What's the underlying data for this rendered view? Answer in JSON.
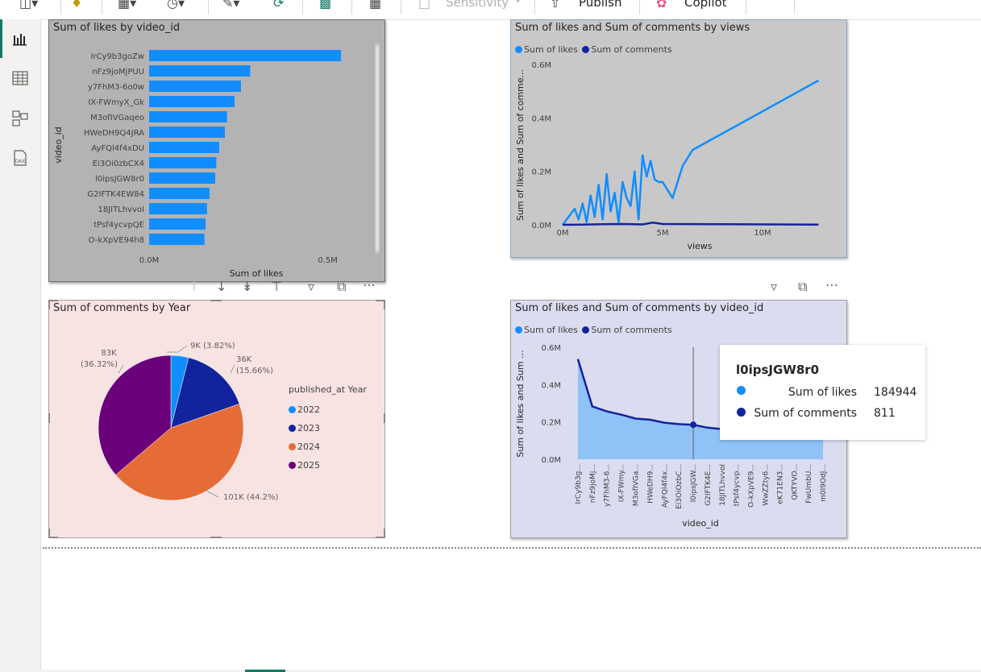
{
  "ribbon": {
    "sensitivity_label": "Sensitivity",
    "publish_label": "Publish",
    "copilot_label": "Copilot"
  },
  "rail": {
    "items": [
      {
        "name": "report-view",
        "icon": "bar-chart-icon"
      },
      {
        "name": "table-view",
        "icon": "table-icon"
      },
      {
        "name": "model-view",
        "icon": "model-icon"
      },
      {
        "name": "dax-query-view",
        "icon": "dax-icon",
        "label": "DAX"
      }
    ]
  },
  "colors": {
    "likes": "#118dff",
    "comments": "#12239e",
    "y2022": "#118dff",
    "y2023": "#12239e",
    "y2024": "#e66c37",
    "y2025": "#6b007b",
    "visual1_bg": "#b3b3b3",
    "visual2_bg": "#c8c8c8",
    "visual3_bg": "#f8e3e3",
    "visual4_bg": "#dcdcf0"
  },
  "visual1": {
    "title": "Sum of likes by video_id",
    "chart_data": {
      "type": "bar",
      "orientation": "horizontal",
      "categories": [
        "IrCy9b3goZw",
        "nFz9joMjPUU",
        "y7FhM3-6o0w",
        "IX-FWmyX_Gk",
        "M3ofIVGaqeo",
        "HWeDH9Q4JRA",
        "AyFQl4f4xDU",
        "Ei3Oi0zbCX4",
        "l0ipsJGW8r0",
        "G2IFTK4EW84",
        "18JITLhvvoI",
        "tPsf4ycvpQE",
        "O-kXpVE94h8"
      ],
      "values": [
        537000,
        283000,
        257000,
        239000,
        218000,
        212000,
        196000,
        188000,
        184944,
        169000,
        162000,
        158000,
        155000
      ],
      "xlabel": "Sum of likes",
      "ylabel": "video_id",
      "xticks": [
        "0.0M",
        "0.5M"
      ],
      "xlim": [
        0,
        600000
      ]
    }
  },
  "visual2": {
    "title": "Sum of likes and Sum of comments by views",
    "legend": [
      "Sum of likes",
      "Sum of comments"
    ],
    "chart_data": {
      "type": "line",
      "xlabel": "views",
      "ylabel": "Sum of likes and Sum of comme...",
      "xticks": [
        "0M",
        "5M",
        "10M"
      ],
      "yticks": [
        "0.0M",
        "0.2M",
        "0.4M",
        "0.6M"
      ],
      "xlim": [
        0,
        12500000
      ],
      "ylim": [
        0,
        600000
      ],
      "series": [
        {
          "name": "Sum of likes",
          "x": [
            0,
            200000,
            400000,
            600000,
            800000,
            1000000,
            1200000,
            1400000,
            1600000,
            1800000,
            2000000,
            2200000,
            2400000,
            2600000,
            2800000,
            3000000,
            3200000,
            3400000,
            3600000,
            3800000,
            4000000,
            4200000,
            4400000,
            4600000,
            4800000,
            5000000,
            5500000,
            6000000,
            6500000,
            12800000
          ],
          "y": [
            0,
            20000,
            40000,
            60000,
            20000,
            80000,
            10000,
            110000,
            30000,
            150000,
            20000,
            190000,
            50000,
            120000,
            10000,
            160000,
            100000,
            70000,
            200000,
            20000,
            260000,
            180000,
            240000,
            170000,
            160000,
            160000,
            100000,
            220000,
            280000,
            540000
          ]
        },
        {
          "name": "Sum of comments",
          "x": [
            0,
            1000000,
            2000000,
            3000000,
            4000000,
            4500000,
            5000000,
            8000000,
            12800000
          ],
          "y": [
            0,
            1000,
            2000,
            3000,
            1500,
            8000,
            3000,
            2000,
            1000
          ]
        }
      ]
    }
  },
  "visual3": {
    "title": "Sum of comments by Year",
    "legend_title": "published_at Year",
    "chart_data": {
      "type": "pie",
      "series_name": "published_at Year",
      "categories": [
        "2022",
        "2023",
        "2024",
        "2025"
      ],
      "values": [
        9000,
        36000,
        101000,
        83000
      ],
      "percents": [
        "3.82%",
        "15.66%",
        "44.2%",
        "36.32%"
      ],
      "value_labels": [
        "9K",
        "36K",
        "101K",
        "83K"
      ]
    },
    "labels": {
      "l2022": "9K (3.82%)",
      "l2023a": "36K",
      "l2023b": "(15.66%)",
      "l2024": "101K (44.2%)",
      "l2025a": "83K",
      "l2025b": "(36.32%)"
    }
  },
  "visual4": {
    "title": "Sum of likes and Sum of comments by video_id",
    "legend": [
      "Sum of likes",
      "Sum of comments"
    ],
    "chart_data": {
      "type": "area",
      "xlabel": "video_id",
      "ylabel": "Sum of likes and Sum ...",
      "categories": [
        "IrCy9b3g...",
        "nFz9joMj...",
        "y7FhM3-6...",
        "IX-FWmy...",
        "M3ofIVGa...",
        "HWeDH9...",
        "AyFQl4f4x...",
        "Ei3OiOzbC...",
        "l0ipsJGW...",
        "G2IFTK4E...",
        "18JITLhvvoI",
        "tPsf4ycvp...",
        "O-kXpVE9...",
        "WwZZty6...",
        "eK71EN3...",
        "QKTYVO...",
        "FwUmbU...",
        "m0I9OdJ..."
      ],
      "yticks": [
        "0.0M",
        "0.2M",
        "0.4M",
        "0.6M"
      ],
      "ylim": [
        0,
        600000
      ],
      "series": [
        {
          "name": "Sum of likes",
          "values": [
            537000,
            283000,
            257000,
            239000,
            218000,
            212000,
            196000,
            188000,
            184944,
            169000,
            162000,
            158000,
            155000,
            152000,
            150000,
            148000,
            146000,
            144000
          ]
        },
        {
          "name": "Sum of comments",
          "values": [
            537000,
            283000,
            257000,
            239000,
            218000,
            212000,
            196000,
            188000,
            184944,
            169000,
            162000,
            158000,
            155000,
            152000,
            150000,
            148000,
            146000,
            144000
          ]
        }
      ]
    },
    "tooltip": {
      "title": "l0ipsJGW8r0",
      "likes_label": "Sum of likes",
      "likes_value": "184944",
      "comments_label": "Sum of comments",
      "comments_value": "811"
    }
  }
}
